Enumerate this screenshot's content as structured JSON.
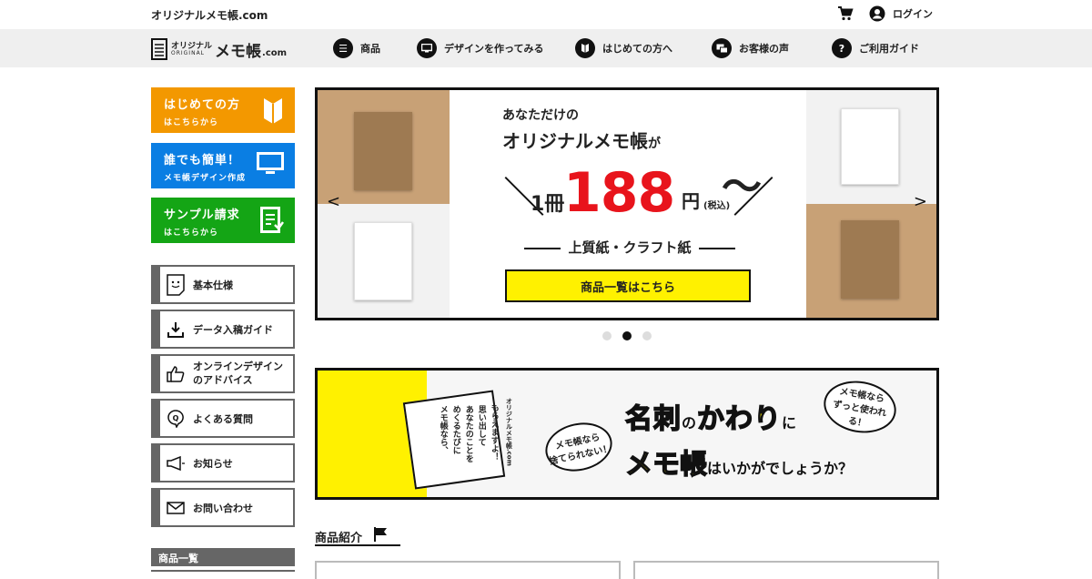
{
  "header": {
    "site_url": "オリジナルメモ帳.com",
    "login_label": "ログイン"
  },
  "logo": {
    "line1": "オリジナル",
    "line2": "ORIGINAL",
    "main": "メモ帳",
    "suffix": ".com"
  },
  "nav": {
    "items": [
      {
        "label": "商品",
        "icon": "list-icon"
      },
      {
        "label": "デザインを作ってみる",
        "icon": "monitor-icon"
      },
      {
        "label": "はじめての方へ",
        "icon": "beginner-icon"
      },
      {
        "label": "お客様の声",
        "icon": "chat-icon"
      },
      {
        "label": "ご利用ガイド",
        "icon": "question-icon"
      }
    ]
  },
  "sidebar": {
    "cta": [
      {
        "title": "はじめての方",
        "sub": "はこちらから",
        "color": "#f39800",
        "icon": "beginner-mark-icon"
      },
      {
        "title": "誰でも簡単！",
        "sub": "メモ帳デザイン作成",
        "color": "#0a7ee3",
        "icon": "monitor-icon"
      },
      {
        "title": "サンプル請求",
        "sub": "はこちらから",
        "color": "#14a515",
        "icon": "document-icon"
      }
    ],
    "menu": [
      {
        "label": "基本仕様",
        "icon": "memo-face-icon"
      },
      {
        "label": "データ入稿ガイド",
        "icon": "download-icon"
      },
      {
        "label": "オンラインデザイン\nのアドバイス",
        "icon": "thumbs-up-icon"
      },
      {
        "label": "よくある質問",
        "icon": "q-bubble-icon"
      },
      {
        "label": "お知らせ",
        "icon": "megaphone-icon"
      },
      {
        "label": "お問い合わせ",
        "icon": "mail-icon"
      }
    ],
    "products_heading": "商品一覧"
  },
  "slider": {
    "line1": "あなただけの",
    "line2": "オリジナルメモ帳",
    "line2_suffix": "が",
    "quantity": "1冊",
    "price": "188",
    "yen": "円",
    "tax": "(税込)",
    "wave": "〜",
    "paper": "上質紙・クラフト紙",
    "button": "商品一覧はこちら",
    "active_dot": 1,
    "dot_count": 3
  },
  "banner": {
    "vertical_lines": [
      "メモ帳なら、",
      "めくるたびに",
      "あなたのことを",
      "思い出して",
      "もらえますよ！"
    ],
    "card_brand": "オリジナルメモ帳.com",
    "bubble_left": "メモ帳なら\n捨てられない！",
    "bubble_right": "メモ帳なら\nずっと使われる！",
    "headline_a": "名刺",
    "headline_b": "の",
    "headline_c": "かわり",
    "headline_d": "に",
    "headline2_a": "メモ帳",
    "headline2_b": "はいかがでしょうか？"
  },
  "section": {
    "title": "商品紹介"
  },
  "colors": {
    "accent_yellow": "#fff100",
    "price_red": "#e8141c",
    "kraft": "#c8a176"
  }
}
